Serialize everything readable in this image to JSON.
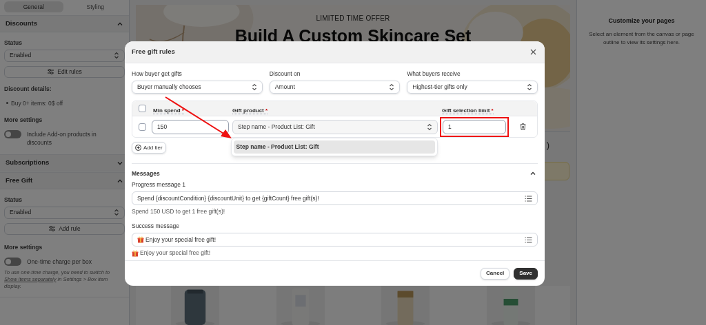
{
  "sidebar": {
    "tabs": [
      {
        "label": "General",
        "selected": true
      },
      {
        "label": "Styling",
        "selected": false
      }
    ],
    "sections": [
      {
        "title": "Discounts",
        "expanded": true,
        "status_label": "Status",
        "status_value": "Enabled",
        "button_label": "Edit rules",
        "details_title": "Discount details:",
        "details_items": [
          "Buy 0+ items: 0$ off"
        ],
        "more_title": "More settings",
        "toggle": {
          "label": "Include Add-on products in discounts",
          "on": false
        }
      },
      {
        "title": "Subscriptions",
        "expanded": false
      },
      {
        "title": "Free Gift",
        "expanded": true,
        "status_label": "Status",
        "status_value": "Enabled",
        "button_label": "Add rule",
        "more_title": "More settings",
        "toggle": {
          "label": "One-time charge per box",
          "on": false
        },
        "note": {
          "before": "To use one-time charge, you need to switch to ",
          "link": "Show items separately",
          "after": " in Settings > Box item display."
        }
      }
    ]
  },
  "canvas": {
    "eyebrow": "LIMITED TIME OFFER",
    "title": "Build A Custom Skincare Set",
    "fragment": ")"
  },
  "right_panel": {
    "title": "Customize your pages",
    "text": "Select an element from the canvas or page outline to view its settings here."
  },
  "modal": {
    "title": "Free gift rules",
    "selects": [
      {
        "label": "How buyer get gifts",
        "value": "Buyer manually chooses"
      },
      {
        "label": "Discount on",
        "value": "Amount"
      },
      {
        "label": "What buyers receive",
        "value": "Highest-tier gifts only"
      }
    ],
    "table": {
      "header_checked": false,
      "columns": [
        {
          "label": "Min spend",
          "required_mark": "*"
        },
        {
          "label": "Gift product",
          "required_mark": "*"
        },
        {
          "label": "Gift selection limit",
          "required_mark": "*"
        }
      ],
      "rows": [
        {
          "checked": false,
          "min_spend": "150",
          "gift_product": "Step name - Product List: Gift",
          "limit": "1"
        }
      ]
    },
    "dropdown": {
      "options": [
        {
          "label": "Step name - Product List: Gift",
          "selected": true
        }
      ]
    },
    "add_tier": "Add tier",
    "messages": {
      "title": "Messages",
      "expanded": true,
      "fields": [
        {
          "label": "Progress message 1",
          "value": "Spend {discountCondition} {discountUnit} to get {giftCount} free gift(s)!",
          "gift_icon": false,
          "preview": "Spend 150 USD to get 1 free gift(s)!"
        },
        {
          "label": "Success message",
          "value": "Enjoy your special free gift!",
          "gift_icon": true,
          "preview": "Enjoy your special free gift!"
        }
      ]
    },
    "buttons": [
      {
        "label": "Cancel",
        "kind": "secondary"
      },
      {
        "label": "Save",
        "kind": "primary"
      }
    ]
  }
}
